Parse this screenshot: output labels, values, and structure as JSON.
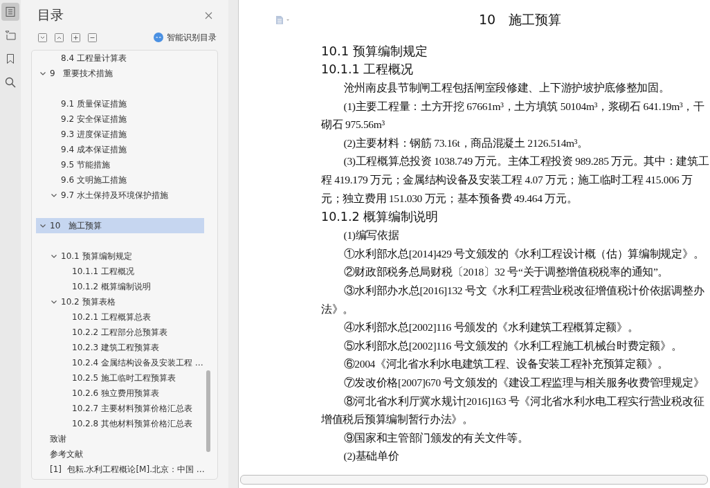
{
  "rail": [
    {
      "kind": "contents",
      "selected": true
    },
    {
      "kind": "outline",
      "selected": false
    },
    {
      "kind": "bookmark",
      "selected": false
    },
    {
      "kind": "search",
      "selected": false
    }
  ],
  "sidebar": {
    "title": "目录",
    "smart_button": "智能识别目录",
    "toc": {
      "leading": [
        {
          "label": "8.4 工程量计算表"
        }
      ],
      "items": [
        {
          "label": "9   重要技术措施",
          "expanded": true,
          "selected": false,
          "gap_after": true,
          "children": [
            {
              "label": "9.1 质量保证措施"
            },
            {
              "label": "9.2 安全保证措施"
            },
            {
              "label": "9.3 进度保证措施"
            },
            {
              "label": "9.4 成本保证措施"
            },
            {
              "label": "9.5 节能措施"
            },
            {
              "label": "9.6 文明施工措施"
            },
            {
              "label": "9.7 水土保持及环境保护措施",
              "expanded": true,
              "gap_after": true
            }
          ]
        },
        {
          "label": "10   施工预算",
          "expanded": true,
          "selected": true,
          "gap_after": true,
          "children": [
            {
              "label": "10.1 预算编制规定",
              "expanded": true,
              "children": [
                {
                  "label": "10.1.1 工程概况"
                },
                {
                  "label": "10.1.2 概算编制说明"
                }
              ]
            },
            {
              "label": "10.2 预算表格",
              "expanded": true,
              "children": [
                {
                  "label": "10.2.1 工程概算总表"
                },
                {
                  "label": "10.2.2 工程部分总预算表"
                },
                {
                  "label": "10.2.3 建筑工程预算表"
                },
                {
                  "label": "10.2.4 金属结构设备及安装工程 …"
                },
                {
                  "label": "10.2.5 施工临时工程预算表"
                },
                {
                  "label": "10.2.6 独立费用预算表"
                },
                {
                  "label": "10.2.7 主要材料预算价格汇总表"
                },
                {
                  "label": "10.2.8 其他材料预算价格汇总表"
                }
              ]
            }
          ]
        },
        {
          "label": "致谢"
        },
        {
          "label": "参考文献"
        },
        {
          "label": "[1]  包耘.水利工程概论[M].北京：中国 …"
        }
      ]
    }
  },
  "document": {
    "title": "10　施工预算",
    "blocks": [
      {
        "kind": "h2",
        "text": "10.1 预算编制规定"
      },
      {
        "kind": "h3",
        "text": "10.1.1 工程概况"
      },
      {
        "kind": "p",
        "text": "沧州南皮县节制闸工程包括闸室段修建、上下游护坡护底修整加固。"
      },
      {
        "kind": "p",
        "text": "(1)主要工程量：土方开挖 67661m³，土方填筑 50104m³，浆砌石 641.19m³，干砌石 975.56m³"
      },
      {
        "kind": "p",
        "text": "(2)主要材料：钢筋 73.16t，商品混凝土 2126.514m³。"
      },
      {
        "kind": "p",
        "text": "(3)工程概算总投资 1038.749 万元。主体工程投资 989.285 万元。其中：建筑工程 419.179 万元；金属结构设备及安装工程 4.07 万元；施工临时工程 415.006 万元；独立费用 151.030 万元；基本预备费 49.464 万元。"
      },
      {
        "kind": "h3",
        "text": "10.1.2 概算编制说明"
      },
      {
        "kind": "p",
        "text": "(1)编写依据"
      },
      {
        "kind": "p",
        "text": "①水利部水总[2014]429 号文颁发的《水利工程设计概（估）算编制规定》。"
      },
      {
        "kind": "p",
        "text": "②财政部税务总局财税〔2018〕32 号“关于调整增值税税率的通知”。"
      },
      {
        "kind": "p",
        "text": "③水利部办水总[2016]132 号文《水利工程营业税改征增值税计价依据调整办法》。"
      },
      {
        "kind": "p",
        "text": "④水利部水总[2002]116 号颁发的《水利建筑工程概算定额》。"
      },
      {
        "kind": "p",
        "text": "⑤水利部水总[2002]116 号文颁发的《水利工程施工机械台时费定额》。"
      },
      {
        "kind": "p",
        "text": "⑥2004《河北省水利水电建筑工程、设备安装工程补充预算定额》。"
      },
      {
        "kind": "p",
        "text": "⑦发改价格[2007]670 号文颁发的《建设工程监理与相关服务收费管理规定》"
      },
      {
        "kind": "p",
        "text": "⑧河北省水利厅冀水规计[2016]163 号《河北省水利水电工程实行营业税改征增值税后预算编制暂行办法》。"
      },
      {
        "kind": "p",
        "text": "⑨国家和主管部门颁发的有关文件等。"
      },
      {
        "kind": "p",
        "text": "(2)基础单价"
      }
    ]
  }
}
